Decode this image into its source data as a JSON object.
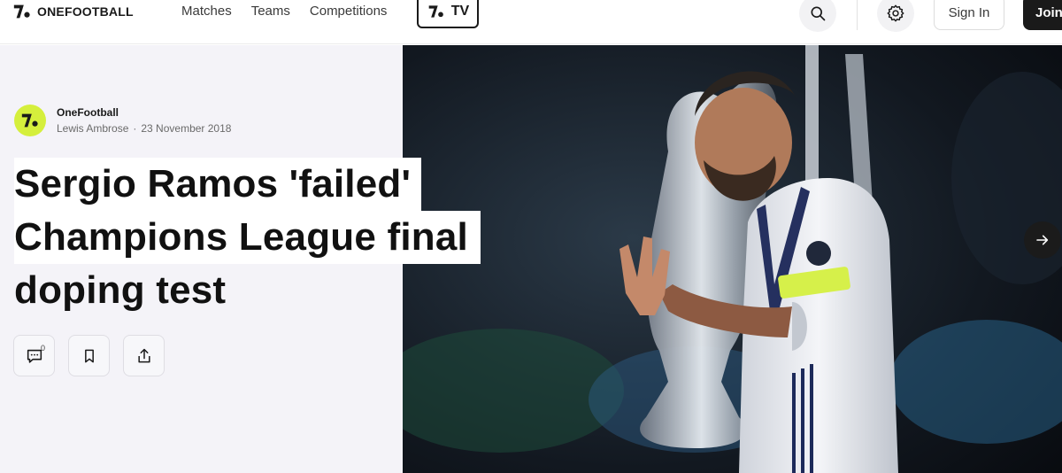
{
  "brand": {
    "name": "ONEFOOTBALL"
  },
  "nav": {
    "items": [
      "Matches",
      "Teams",
      "Competitions"
    ]
  },
  "tv": {
    "label": "TV"
  },
  "header_actions": {
    "signin_label": "Sign In",
    "join_label": "Join"
  },
  "article": {
    "publisher": "OneFootball",
    "author": "Lewis Ambrose",
    "separator": "·",
    "date": "23 November 2018",
    "headline_lines": [
      "Sergio Ramos 'failed'",
      "Champions League final",
      "doping test"
    ],
    "comment_count": "0"
  },
  "icons": {
    "search": "search-icon",
    "settings": "gear-icon",
    "comments": "comment-icon",
    "bookmark": "bookmark-icon",
    "share": "share-icon",
    "next": "arrow-right-icon"
  },
  "colors": {
    "brand_accent": "#d5ef3c",
    "panel_bg": "#f4f3f8",
    "join_bg": "#1a1a1a"
  }
}
